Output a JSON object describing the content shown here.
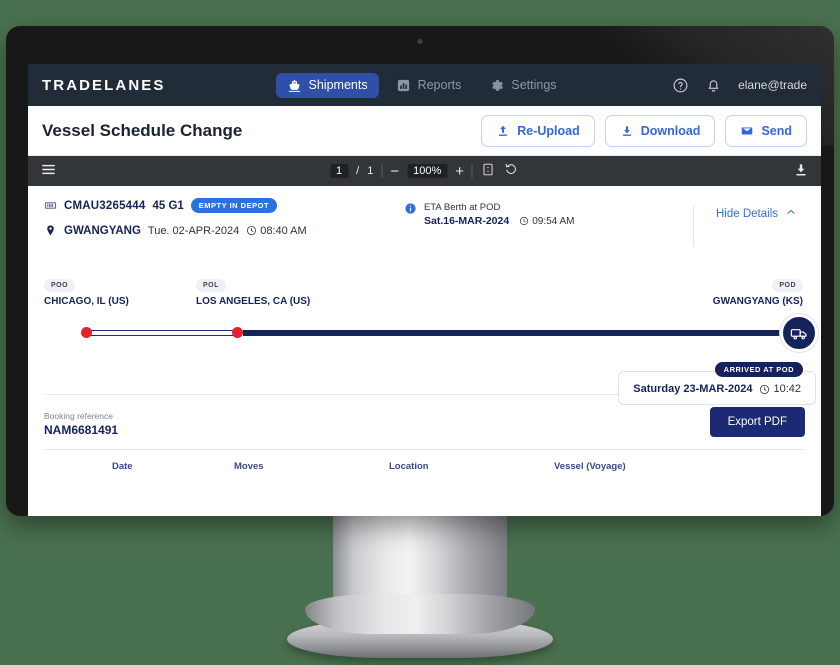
{
  "brand": {
    "name": "TRADELANES"
  },
  "nav": {
    "items": [
      {
        "label": "Shipments",
        "icon": "ship-icon",
        "active": true
      },
      {
        "label": "Reports",
        "icon": "bar-chart-icon",
        "active": false
      },
      {
        "label": "Settings",
        "icon": "gear-icon",
        "active": false
      }
    ],
    "help_icon": "help-circle-icon",
    "bell_icon": "bell-icon",
    "user_email": "elane@trade"
  },
  "header": {
    "title": "Vessel Schedule Change",
    "actions": [
      {
        "label": "Re-Upload",
        "icon": "upload-icon"
      },
      {
        "label": "Download",
        "icon": "download-icon"
      },
      {
        "label": "Send",
        "icon": "envelope-icon"
      }
    ]
  },
  "pdf_toolbar": {
    "menu_icon": "hamburger-menu-icon",
    "current_page": "1",
    "page_separator": "/",
    "total_pages": "1",
    "zoom_out": "−",
    "zoom_level": "100%",
    "zoom_in": "+",
    "fit_icon": "fit-page-icon",
    "rotate_icon": "rotate-icon",
    "download_icon": "download-icon"
  },
  "document": {
    "container": {
      "icon": "container-icon",
      "id": "CMAU3265444",
      "type": "45 G1",
      "status_badge": "EMPTY IN DEPOT"
    },
    "location": {
      "icon": "map-pin-icon",
      "name": "GWANGYANG",
      "date": "Tue. 02-APR-2024",
      "clock_icon": "clock-icon",
      "time": "08:40 AM"
    },
    "eta": {
      "info_icon": "info-circle-icon",
      "label": "ETA Berth at POD",
      "date": "Sat.16-MAR-2024",
      "clock_icon": "clock-icon",
      "time": "09:54 AM"
    },
    "hide_details": {
      "label": "Hide Details",
      "icon": "chevron-up-icon"
    },
    "timeline": {
      "nodes": [
        {
          "tag": "POO",
          "city": "CHICAGO, IL (US)"
        },
        {
          "tag": "POL",
          "city": "LOS ANGELES, CA (US)"
        },
        {
          "tag": "POD",
          "city": "GWANGYANG (KS)"
        }
      ],
      "vehicle_icon": "truck-icon",
      "arrived_badge": "ARRIVED AT POD",
      "arrived_date": "Saturday 23-MAR-2024",
      "arrived_clock_icon": "clock-icon",
      "arrived_time": "10:42"
    },
    "booking": {
      "label": "Booking reference",
      "value": "NAM6681491"
    },
    "export_button": "Export PDF",
    "table": {
      "columns": [
        "Date",
        "Moves",
        "Location",
        "Vessel (Voyage)"
      ]
    }
  },
  "colors": {
    "background": "#4a714f",
    "nav_bg": "#222b38",
    "nav_active": "#2f4fa8",
    "accent_blue": "#3366dd",
    "navy": "#16235a",
    "badge_blue": "#2f6fe4",
    "dot_red": "#e8202a",
    "toolbar_bg": "#323639"
  }
}
